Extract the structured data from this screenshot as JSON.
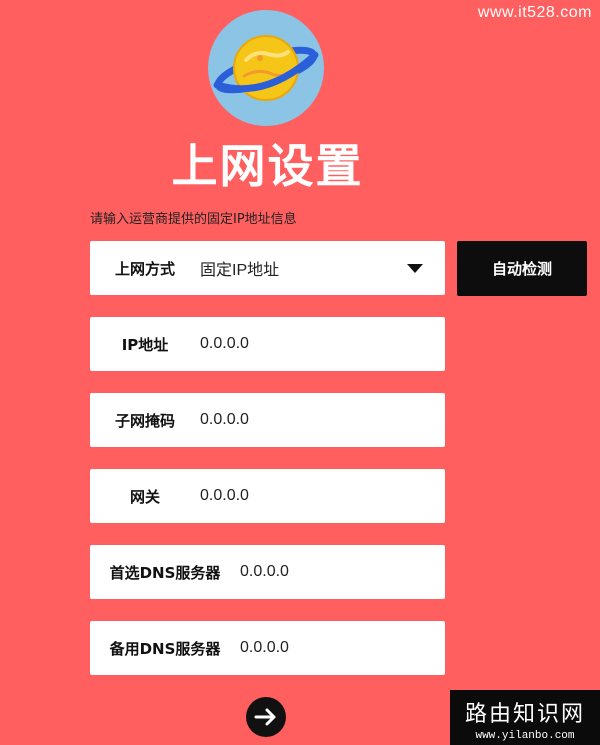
{
  "watermark_top": "www.it528.com",
  "title": "上网设置",
  "hint": "请输入运营商提供的固定IP地址信息",
  "fields": [
    {
      "label": "上网方式",
      "value": "固定IP地址"
    },
    {
      "label": "IP地址",
      "value": "0.0.0.0"
    },
    {
      "label": "子网掩码",
      "value": "0.0.0.0"
    },
    {
      "label": "网关",
      "value": "0.0.0.0"
    },
    {
      "label": "首选DNS服务器",
      "value": "0.0.0.0"
    },
    {
      "label": "备用DNS服务器",
      "value": "0.0.0.0"
    }
  ],
  "detect_button": "自动检测",
  "watermark_box": {
    "name": "路由知识网",
    "url": "www.yilanbo.com"
  },
  "icons": {
    "logo": "planet-icon",
    "next": "arrow-right-icon",
    "dropdown": "caret-down-icon"
  },
  "colors": {
    "background": "#FF5F5F",
    "button": "#0D0D0D",
    "logo_bg": "#8CC4E6",
    "planet": "#F5C518"
  }
}
